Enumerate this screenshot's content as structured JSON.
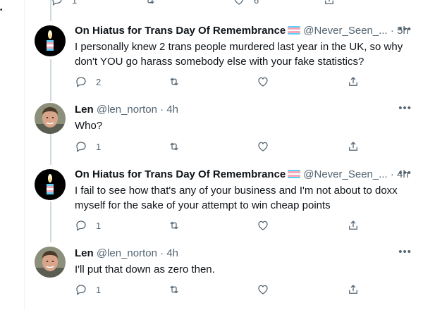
{
  "colors": {
    "text": "#0f1419",
    "secondary": "#536471",
    "line": "#cfd9de",
    "border": "#eff3f4"
  },
  "top_partial": {
    "reply_count": "1",
    "like_count": "6"
  },
  "tweets": [
    {
      "author": "On Hiatus for Trans Day Of Remembrance",
      "has_flag": true,
      "handle": "@Never_Seen_...",
      "dot": "·",
      "time": "5h",
      "more": "•••",
      "text": "I personally knew 2 trans people murdered last year in the UK, so why don't YOU go harass somebody else with your fake statistics?",
      "reply_count": "2",
      "avatar": "candle-avatar"
    },
    {
      "author": "Len",
      "has_flag": false,
      "handle": "@len_norton",
      "dot": "·",
      "time": "4h",
      "more": "•••",
      "text": "Who?",
      "reply_count": "1",
      "avatar": "person-avatar"
    },
    {
      "author": "On Hiatus for Trans Day Of Remembrance",
      "has_flag": true,
      "handle": "@Never_Seen_...",
      "dot": "·",
      "time": "4h",
      "more": "•••",
      "text": "I fail to see how that's any of your business and I'm not about to doxx myself for the sake of your attempt to win cheap points",
      "reply_count": "1",
      "avatar": "candle-avatar"
    },
    {
      "author": "Len",
      "has_flag": false,
      "handle": "@len_norton",
      "dot": "·",
      "time": "4h",
      "more": "•••",
      "text": "I'll put that down as zero then.",
      "reply_count": "1",
      "avatar": "person-avatar"
    }
  ],
  "icons": [
    "reply-icon",
    "retweet-icon",
    "like-icon",
    "share-icon",
    "more-icon",
    "trans-flag-icon"
  ]
}
